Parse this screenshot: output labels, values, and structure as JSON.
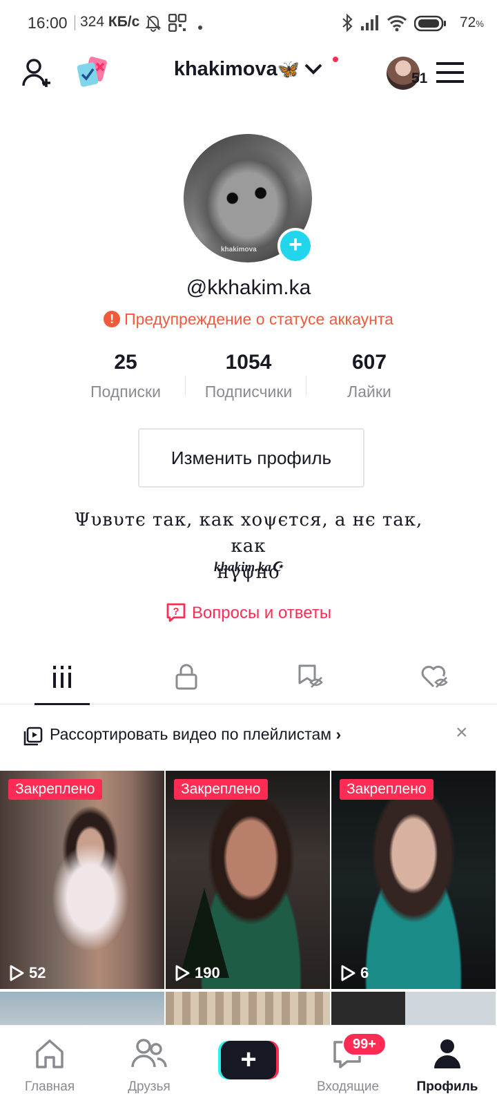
{
  "status_bar": {
    "time": "16:00",
    "speed_value": "324",
    "speed_unit": "КБ/с",
    "battery_value": "72",
    "battery_unit": "%"
  },
  "header": {
    "title": "khakimova",
    "title_emoji": "🦋",
    "avatar_count": "51"
  },
  "profile": {
    "avatar_caption": "khakimova",
    "handle": "@kkhakim.ka",
    "warning": "Предупреждение о статусе аккаунта",
    "stats": [
      {
        "value": "25",
        "label": "Подписки"
      },
      {
        "value": "1054",
        "label": "Подписчики"
      },
      {
        "value": "607",
        "label": "Лайки"
      }
    ],
    "edit_button": "Изменить профиль",
    "bio_line1": "Ψυвυтє тaк, кaк xoψєтcя, a нє тaк, кaк",
    "bio_line2": "нγψнo",
    "bio_signature": "khakim.ka☪",
    "qa_link": "Вопросы и ответы"
  },
  "tabs": [
    {
      "icon": "grid-icon",
      "active": true
    },
    {
      "icon": "lock-icon",
      "active": false
    },
    {
      "icon": "bookmark-hidden-icon",
      "active": false
    },
    {
      "icon": "heart-hidden-icon",
      "active": false
    }
  ],
  "playlist_banner": {
    "text": "Рассортировать видео по плейлистам",
    "chevron": "›",
    "close": "×"
  },
  "videos": [
    {
      "pinned_label": "Закреплено",
      "views": "52"
    },
    {
      "pinned_label": "Закреплено",
      "views": "190"
    },
    {
      "pinned_label": "Закреплено",
      "views": "6"
    }
  ],
  "bottom_nav": {
    "home": "Главная",
    "friends": "Друзья",
    "create": "+",
    "inbox": "Входящие",
    "inbox_badge": "99+",
    "profile": "Профиль"
  },
  "colors": {
    "accent": "#fe2c55",
    "cyan": "#20d5ec",
    "warning": "#f25a3c",
    "text": "#161823",
    "muted": "#8a8b91"
  }
}
